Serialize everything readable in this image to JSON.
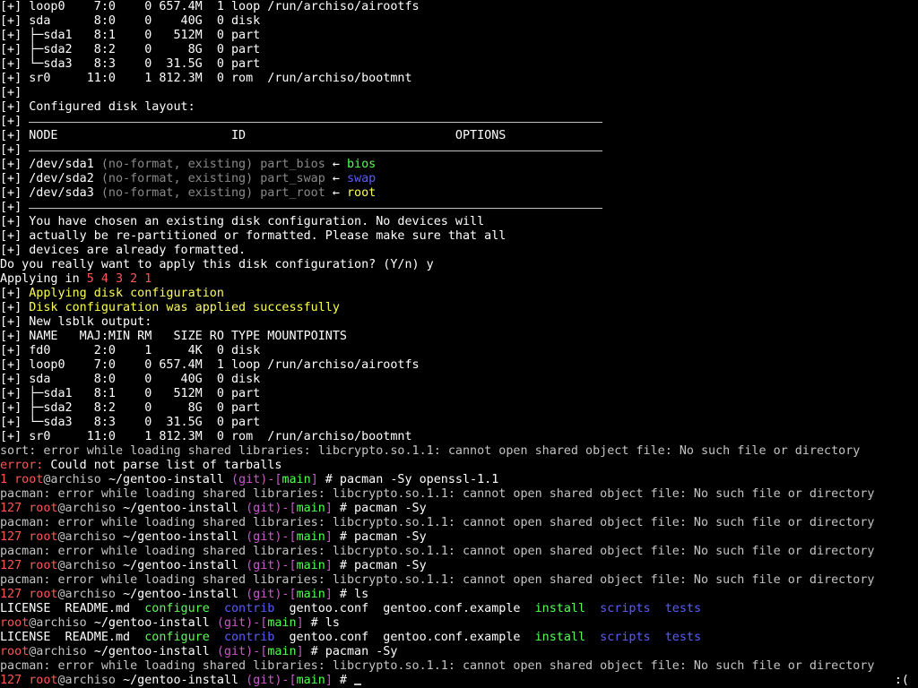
{
  "terminal": {
    "lines": [
      {
        "segments": [
          {
            "t": "[+] loop0    7:0    0 657.4M  1 loop /run/archiso/airootfs",
            "c": "w"
          }
        ]
      },
      {
        "segments": [
          {
            "t": "[+] sda      8:0    0    40G  0 disk",
            "c": "w"
          }
        ]
      },
      {
        "segments": [
          {
            "t": "[+] ├─sda1   8:1    0   512M  0 part",
            "c": "w"
          }
        ]
      },
      {
        "segments": [
          {
            "t": "[+] ├─sda2   8:2    0     8G  0 part",
            "c": "w"
          }
        ]
      },
      {
        "segments": [
          {
            "t": "[+] └─sda3   8:3    0  31.5G  0 part",
            "c": "w"
          }
        ]
      },
      {
        "segments": [
          {
            "t": "[+] sr0     11:0    1 812.3M  0 rom  /run/archiso/bootmnt",
            "c": "w"
          }
        ]
      },
      {
        "segments": [
          {
            "t": "[+]",
            "c": "w"
          }
        ]
      },
      {
        "segments": [
          {
            "t": "[+] Configured disk layout:",
            "c": "w"
          }
        ]
      },
      {
        "segments": [
          {
            "t": "[+]",
            "c": "w"
          }
        ],
        "rule": true
      },
      {
        "segments": [
          {
            "t": "[+] NODE                        ID                             OPTIONS",
            "c": "w"
          }
        ]
      },
      {
        "segments": [
          {
            "t": "[+]",
            "c": "w"
          }
        ],
        "rule": true
      },
      {
        "segments": [
          {
            "t": "[+] /dev/sda1 ",
            "c": "w"
          },
          {
            "t": "(no-format, existing) part_bios",
            "c": "g"
          },
          {
            "t": " ← ",
            "c": "w"
          },
          {
            "t": "bios",
            "c": "gn"
          }
        ]
      },
      {
        "segments": [
          {
            "t": "[+] /dev/sda2 ",
            "c": "w"
          },
          {
            "t": "(no-format, existing) part_swap",
            "c": "g"
          },
          {
            "t": " ← ",
            "c": "w"
          },
          {
            "t": "swap",
            "c": "bl"
          }
        ]
      },
      {
        "segments": [
          {
            "t": "[+] /dev/sda3 ",
            "c": "w"
          },
          {
            "t": "(no-format, existing) part_root",
            "c": "g"
          },
          {
            "t": " ← ",
            "c": "w"
          },
          {
            "t": "root",
            "c": "y"
          }
        ]
      },
      {
        "segments": [
          {
            "t": "[+]",
            "c": "w"
          }
        ],
        "rule": true
      },
      {
        "segments": [
          {
            "t": "[+] You have chosen an existing disk configuration. No devices will",
            "c": "w"
          }
        ]
      },
      {
        "segments": [
          {
            "t": "[+] actually be re-partitioned or formatted. Please make sure that all",
            "c": "w"
          }
        ]
      },
      {
        "segments": [
          {
            "t": "[+] devices are already formatted.",
            "c": "w"
          }
        ]
      },
      {
        "segments": [
          {
            "t": "Do you really want to apply this disk configuration? (Y/n) y",
            "c": "w"
          }
        ]
      },
      {
        "segments": [
          {
            "t": "Applying in ",
            "c": "w"
          },
          {
            "t": "5 4 3 2 1",
            "c": "r"
          }
        ]
      },
      {
        "segments": [
          {
            "t": "[+] ",
            "c": "w"
          },
          {
            "t": "Applying disk configuration",
            "c": "yb"
          }
        ]
      },
      {
        "segments": [
          {
            "t": "[+] ",
            "c": "w"
          },
          {
            "t": "Disk configuration was applied successfully",
            "c": "yb"
          }
        ]
      },
      {
        "segments": [
          {
            "t": "[+] New lsblk output:",
            "c": "w"
          }
        ]
      },
      {
        "segments": [
          {
            "t": "[+] NAME   MAJ:MIN RM   SIZE RO TYPE MOUNTPOINTS",
            "c": "w"
          }
        ]
      },
      {
        "segments": [
          {
            "t": "[+] fd0      2:0    1     4K  0 disk",
            "c": "w"
          }
        ]
      },
      {
        "segments": [
          {
            "t": "[+] loop0    7:0    0 657.4M  1 loop /run/archiso/airootfs",
            "c": "w"
          }
        ]
      },
      {
        "segments": [
          {
            "t": "[+] sda      8:0    0    40G  0 disk",
            "c": "w"
          }
        ]
      },
      {
        "segments": [
          {
            "t": "[+] ├─sda1   8:1    0   512M  0 part",
            "c": "w"
          }
        ]
      },
      {
        "segments": [
          {
            "t": "[+] ├─sda2   8:2    0     8G  0 part",
            "c": "w"
          }
        ]
      },
      {
        "segments": [
          {
            "t": "[+] └─sda3   8:3    0  31.5G  0 part",
            "c": "w"
          }
        ]
      },
      {
        "segments": [
          {
            "t": "[+] sr0     11:0    1 812.3M  0 rom  /run/archiso/bootmnt",
            "c": "w"
          }
        ]
      },
      {
        "segments": [
          {
            "t": "sort: error while loading shared libraries: libcrypto.so.1.1: cannot open shared object file: No such file or directory",
            "c": "d"
          }
        ]
      },
      {
        "segments": [
          {
            "t": "error:",
            "c": "r"
          },
          {
            "t": " Could not parse list of tarballs",
            "c": "w"
          }
        ]
      },
      {
        "segments": [
          {
            "t": "1 ",
            "c": "r"
          },
          {
            "t": "root",
            "c": "r"
          },
          {
            "t": "@archiso ",
            "c": "d"
          },
          {
            "t": "~/gentoo-install ",
            "c": "w"
          },
          {
            "t": "(git)-[",
            "c": "m"
          },
          {
            "t": "main",
            "c": "gn"
          },
          {
            "t": "]",
            "c": "m"
          },
          {
            "t": " # pacman -Sy openssl-1.1",
            "c": "w"
          }
        ]
      },
      {
        "segments": [
          {
            "t": "pacman: error while loading shared libraries: libcrypto.so.1.1: cannot open shared object file: No such file or directory",
            "c": "d"
          }
        ]
      },
      {
        "segments": [
          {
            "t": "127 ",
            "c": "r"
          },
          {
            "t": "root",
            "c": "r"
          },
          {
            "t": "@archiso ",
            "c": "d"
          },
          {
            "t": "~/gentoo-install ",
            "c": "w"
          },
          {
            "t": "(git)-[",
            "c": "m"
          },
          {
            "t": "main",
            "c": "gn"
          },
          {
            "t": "]",
            "c": "m"
          },
          {
            "t": " # pacman -Sy",
            "c": "w"
          }
        ]
      },
      {
        "segments": [
          {
            "t": "pacman: error while loading shared libraries: libcrypto.so.1.1: cannot open shared object file: No such file or directory",
            "c": "d"
          }
        ]
      },
      {
        "segments": [
          {
            "t": "127 ",
            "c": "r"
          },
          {
            "t": "root",
            "c": "r"
          },
          {
            "t": "@archiso ",
            "c": "d"
          },
          {
            "t": "~/gentoo-install ",
            "c": "w"
          },
          {
            "t": "(git)-[",
            "c": "m"
          },
          {
            "t": "main",
            "c": "gn"
          },
          {
            "t": "]",
            "c": "m"
          },
          {
            "t": " # pacman -Sy",
            "c": "w"
          }
        ]
      },
      {
        "segments": [
          {
            "t": "pacman: error while loading shared libraries: libcrypto.so.1.1: cannot open shared object file: No such file or directory",
            "c": "d"
          }
        ]
      },
      {
        "segments": [
          {
            "t": "127 ",
            "c": "r"
          },
          {
            "t": "root",
            "c": "r"
          },
          {
            "t": "@archiso ",
            "c": "d"
          },
          {
            "t": "~/gentoo-install ",
            "c": "w"
          },
          {
            "t": "(git)-[",
            "c": "m"
          },
          {
            "t": "main",
            "c": "gn"
          },
          {
            "t": "]",
            "c": "m"
          },
          {
            "t": " # pacman -Sy",
            "c": "w"
          }
        ]
      },
      {
        "segments": [
          {
            "t": "pacman: error while loading shared libraries: libcrypto.so.1.1: cannot open shared object file: No such file or directory",
            "c": "d"
          }
        ]
      },
      {
        "segments": [
          {
            "t": "127 ",
            "c": "r"
          },
          {
            "t": "root",
            "c": "r"
          },
          {
            "t": "@archiso ",
            "c": "d"
          },
          {
            "t": "~/gentoo-install ",
            "c": "w"
          },
          {
            "t": "(git)-[",
            "c": "m"
          },
          {
            "t": "main",
            "c": "gn"
          },
          {
            "t": "]",
            "c": "m"
          },
          {
            "t": " # ls",
            "c": "w"
          }
        ]
      },
      {
        "segments": [
          {
            "t": "LICENSE  README.md  ",
            "c": "w"
          },
          {
            "t": "configure",
            "c": "gn"
          },
          {
            "t": "  ",
            "c": "w"
          },
          {
            "t": "contrib",
            "c": "bl"
          },
          {
            "t": "  gentoo.conf  gentoo.conf.example  ",
            "c": "w"
          },
          {
            "t": "install",
            "c": "gn"
          },
          {
            "t": "  ",
            "c": "w"
          },
          {
            "t": "scripts",
            "c": "bl"
          },
          {
            "t": "  ",
            "c": "w"
          },
          {
            "t": "tests",
            "c": "bl"
          }
        ]
      },
      {
        "segments": [
          {
            "t": "root",
            "c": "r"
          },
          {
            "t": "@archiso ",
            "c": "d"
          },
          {
            "t": "~/gentoo-install ",
            "c": "w"
          },
          {
            "t": "(git)-[",
            "c": "m"
          },
          {
            "t": "main",
            "c": "gn"
          },
          {
            "t": "]",
            "c": "m"
          },
          {
            "t": " # ls",
            "c": "w"
          }
        ]
      },
      {
        "segments": [
          {
            "t": "LICENSE  README.md  ",
            "c": "w"
          },
          {
            "t": "configure",
            "c": "gn"
          },
          {
            "t": "  ",
            "c": "w"
          },
          {
            "t": "contrib",
            "c": "bl"
          },
          {
            "t": "  gentoo.conf  gentoo.conf.example  ",
            "c": "w"
          },
          {
            "t": "install",
            "c": "gn"
          },
          {
            "t": "  ",
            "c": "w"
          },
          {
            "t": "scripts",
            "c": "bl"
          },
          {
            "t": "  ",
            "c": "w"
          },
          {
            "t": "tests",
            "c": "bl"
          }
        ]
      },
      {
        "segments": [
          {
            "t": "root",
            "c": "r"
          },
          {
            "t": "@archiso ",
            "c": "d"
          },
          {
            "t": "~/gentoo-install ",
            "c": "w"
          },
          {
            "t": "(git)-[",
            "c": "m"
          },
          {
            "t": "main",
            "c": "gn"
          },
          {
            "t": "]",
            "c": "m"
          },
          {
            "t": " # pacman -Sy",
            "c": "w"
          }
        ]
      },
      {
        "segments": [
          {
            "t": "pacman: error while loading shared libraries: libcrypto.so.1.1: cannot open shared object file: No such file or directory",
            "c": "d"
          }
        ]
      },
      {
        "segments": [
          {
            "t": "127 ",
            "c": "r"
          },
          {
            "t": "root",
            "c": "r"
          },
          {
            "t": "@archiso ",
            "c": "d"
          },
          {
            "t": "~/gentoo-install ",
            "c": "w"
          },
          {
            "t": "(git)-[",
            "c": "m"
          },
          {
            "t": "main",
            "c": "gn"
          },
          {
            "t": "]",
            "c": "m"
          },
          {
            "t": " # ",
            "c": "w"
          }
        ]
      }
    ],
    "right_prompt": ":(",
    "colors": {
      "background": "#000000",
      "foreground": "#c4c4c4",
      "red": "#ff5555",
      "green": "#55ff55",
      "blue": "#5c5cff",
      "yellow": "#fefe54",
      "magenta": "#c85ac8",
      "dim": "#8a8a8a"
    }
  }
}
